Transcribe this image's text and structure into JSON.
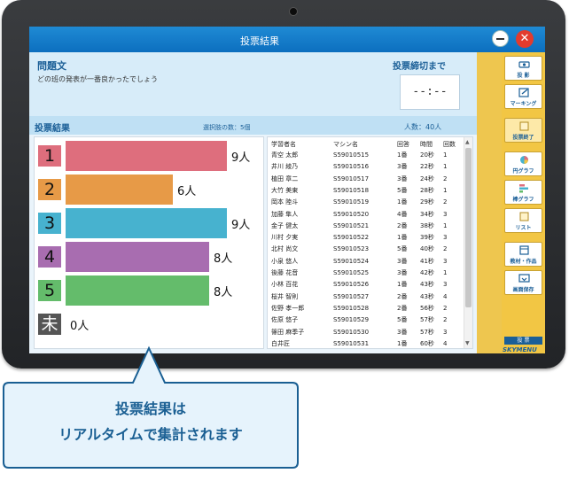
{
  "window": {
    "title": "投票結果",
    "close_glyph": "✕"
  },
  "question": {
    "heading": "問題文",
    "text": "どの班の発表が一番良かったでしょう"
  },
  "deadline": {
    "label": "投票締切まで",
    "value": "--:--"
  },
  "results": {
    "heading": "投票結果",
    "choices_count": "選択肢の数：5個",
    "people_count": "人数：40人",
    "bars": [
      {
        "label": "1",
        "count_text": "9人",
        "count": 9,
        "color": "#de6e7d",
        "box_color": "#de6e7d"
      },
      {
        "label": "2",
        "count_text": "6人",
        "count": 6,
        "color": "#e79a47",
        "box_color": "#e79a47"
      },
      {
        "label": "3",
        "count_text": "9人",
        "count": 9,
        "color": "#47b2cf",
        "box_color": "#47b2cf"
      },
      {
        "label": "4",
        "count_text": "8人",
        "count": 8,
        "color": "#a86db0",
        "box_color": "#a86db0"
      },
      {
        "label": "5",
        "count_text": "8人",
        "count": 8,
        "color": "#64bc6b",
        "box_color": "#64bc6b"
      },
      {
        "label": "未",
        "count_text": "0人",
        "count": 0,
        "color": "#555555",
        "box_color": "#555555"
      }
    ]
  },
  "table": {
    "headers": [
      "学習者名",
      "マシン名",
      "回答",
      "時間",
      "回数"
    ],
    "rows": [
      [
        "青空 太郎",
        "S59010515",
        "1番",
        "20秒",
        "1"
      ],
      [
        "井川 綾乃",
        "S59010516",
        "3番",
        "22秒",
        "1"
      ],
      [
        "植田 章二",
        "S59010517",
        "3番",
        "24秒",
        "2"
      ],
      [
        "大竹 美東",
        "S59010518",
        "5番",
        "28秒",
        "1"
      ],
      [
        "岡本 陸斗",
        "S59010519",
        "1番",
        "29秒",
        "2"
      ],
      [
        "加藤 隼人",
        "S59010520",
        "4番",
        "34秒",
        "3"
      ],
      [
        "金子 健太",
        "S59010521",
        "2番",
        "38秒",
        "1"
      ],
      [
        "川村 夕実",
        "S59010522",
        "1番",
        "39秒",
        "3"
      ],
      [
        "北村 尚文",
        "S59010523",
        "5番",
        "40秒",
        "2"
      ],
      [
        "小泉 悠人",
        "S59010524",
        "3番",
        "41秒",
        "3"
      ],
      [
        "後藤 花音",
        "S59010525",
        "3番",
        "42秒",
        "1"
      ],
      [
        "小林 百花",
        "S59010526",
        "1番",
        "43秒",
        "3"
      ],
      [
        "桜井 智則",
        "S59010527",
        "2番",
        "43秒",
        "4"
      ],
      [
        "佐野 孝一郎",
        "S59010528",
        "2番",
        "56秒",
        "2"
      ],
      [
        "佐原 悠子",
        "S59010529",
        "5番",
        "57秒",
        "2"
      ],
      [
        "篠田 麻季子",
        "S59010530",
        "3番",
        "57秒",
        "3"
      ],
      [
        "白井匠",
        "S59010531",
        "1番",
        "60秒",
        "4"
      ]
    ]
  },
  "sidebar": {
    "tools": [
      {
        "label": "投 影",
        "icon": "projector-icon"
      },
      {
        "label": "マーキング",
        "icon": "marking-icon"
      },
      {
        "label": "投票終了",
        "icon": "vote-end-icon"
      },
      {
        "label": "円グラフ",
        "icon": "pie-chart-icon"
      },
      {
        "label": "棒グラフ",
        "icon": "bar-chart-icon"
      },
      {
        "label": "リスト",
        "icon": "list-icon"
      },
      {
        "label": "教材・作品",
        "icon": "materials-icon"
      },
      {
        "label": "画面保存",
        "icon": "screen-save-icon"
      }
    ],
    "tag": "投 票",
    "brand": "SKYMENU"
  },
  "callout": {
    "line1": "投票結果は",
    "line2": "リアルタイムで集計されます"
  }
}
